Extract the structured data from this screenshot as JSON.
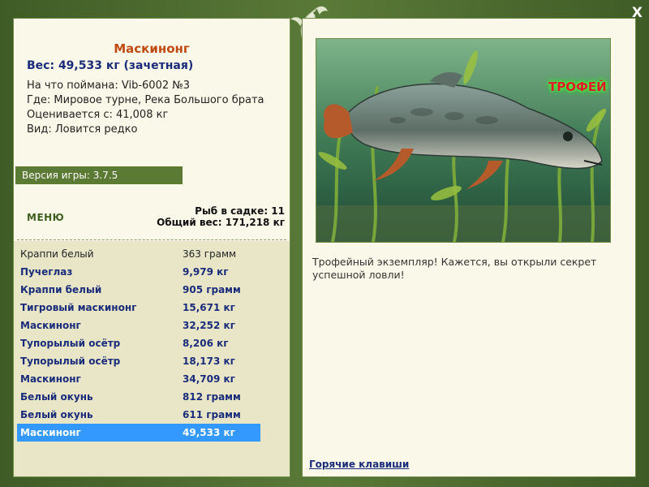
{
  "window": {
    "close_label": "X"
  },
  "fish": {
    "title": "Маскинонг",
    "weight": "Вес: 49,533 кг (зачетная)",
    "bait": "На что поймана: Vib-6002 №3",
    "where": "Где: Мировое турне, Река Большого брата",
    "valued": "Оцениваетcя с: 41,008 кг",
    "kind": "Вид: Ловится редко"
  },
  "version": "Версия игры: 3.7.5",
  "menu_label": "МЕНЮ",
  "stats": {
    "count": "Рыб в садке: 11",
    "total": "Общий вес: 171,218 кг"
  },
  "catches": [
    {
      "name": "Краппи белый",
      "weight": "363 грамм",
      "style": "plain"
    },
    {
      "name": "Пучеглаз",
      "weight": "9,979 кг",
      "style": "bold"
    },
    {
      "name": "Краппи белый",
      "weight": "905 грамм",
      "style": "bold"
    },
    {
      "name": "Тигровый маскинонг",
      "weight": "15,671 кг",
      "style": "bold"
    },
    {
      "name": "Маскинонг",
      "weight": "32,252 кг",
      "style": "bold"
    },
    {
      "name": "Тупорылый осётр",
      "weight": "8,206 кг",
      "style": "bold"
    },
    {
      "name": "Тупорылый осётр",
      "weight": "18,173 кг",
      "style": "bold"
    },
    {
      "name": "Маскинонг",
      "weight": "34,709 кг",
      "style": "bold"
    },
    {
      "name": "Белый окунь",
      "weight": "812 грамм",
      "style": "bold"
    },
    {
      "name": "Белый окунь",
      "weight": "611 грамм",
      "style": "bold"
    },
    {
      "name": "Маскинонг",
      "weight": "49,533 кг",
      "style": "sel"
    }
  ],
  "trophy_label": "ТРОФЕЙ",
  "description": "Трофейный экземпляр! Кажется, вы открыли секрет успешной ловли!",
  "hotkeys_label": "Горячие клавиши",
  "colors": {
    "frame": "#4f6b30",
    "panel": "#faf8e8",
    "list_bg": "#e8e6c7",
    "accent_title": "#c04a10",
    "text_blue": "#1a2c7a",
    "selection": "#3399ff",
    "version_bar": "#5b7a33"
  },
  "icons": {
    "logo": "fish-logo-icon",
    "close": "close-icon"
  }
}
